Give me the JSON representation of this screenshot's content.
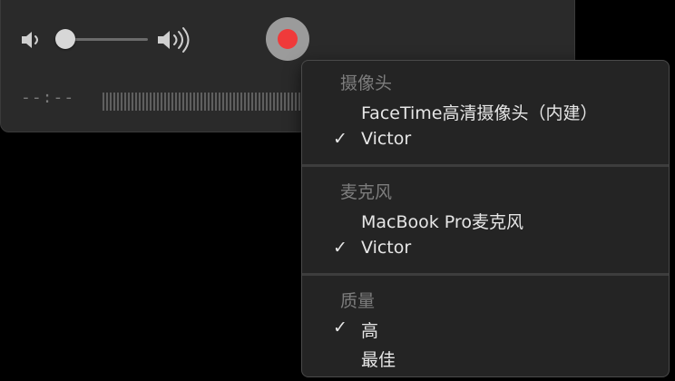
{
  "hud": {
    "time": "--:--",
    "volume_level": 0.0
  },
  "icons": {
    "volume_low": "speaker-low-icon",
    "volume_high": "speaker-high-icon",
    "record": "record-icon",
    "check": "checkmark-icon"
  },
  "colors": {
    "record_red": "#ef3a3a",
    "menu_background": "#242424"
  },
  "menu": {
    "check_glyph": "✓",
    "sections": [
      {
        "title": "摄像头",
        "items": [
          {
            "label": "FaceTime高清摄像头（内建）",
            "checked": false
          },
          {
            "label": "Victor",
            "checked": true
          }
        ]
      },
      {
        "title": "麦克风",
        "items": [
          {
            "label": "MacBook Pro麦克风",
            "checked": false
          },
          {
            "label": "Victor",
            "checked": true
          }
        ]
      },
      {
        "title": "质量",
        "items": [
          {
            "label": "高",
            "checked": true
          },
          {
            "label": "最佳",
            "checked": false
          }
        ]
      }
    ]
  }
}
